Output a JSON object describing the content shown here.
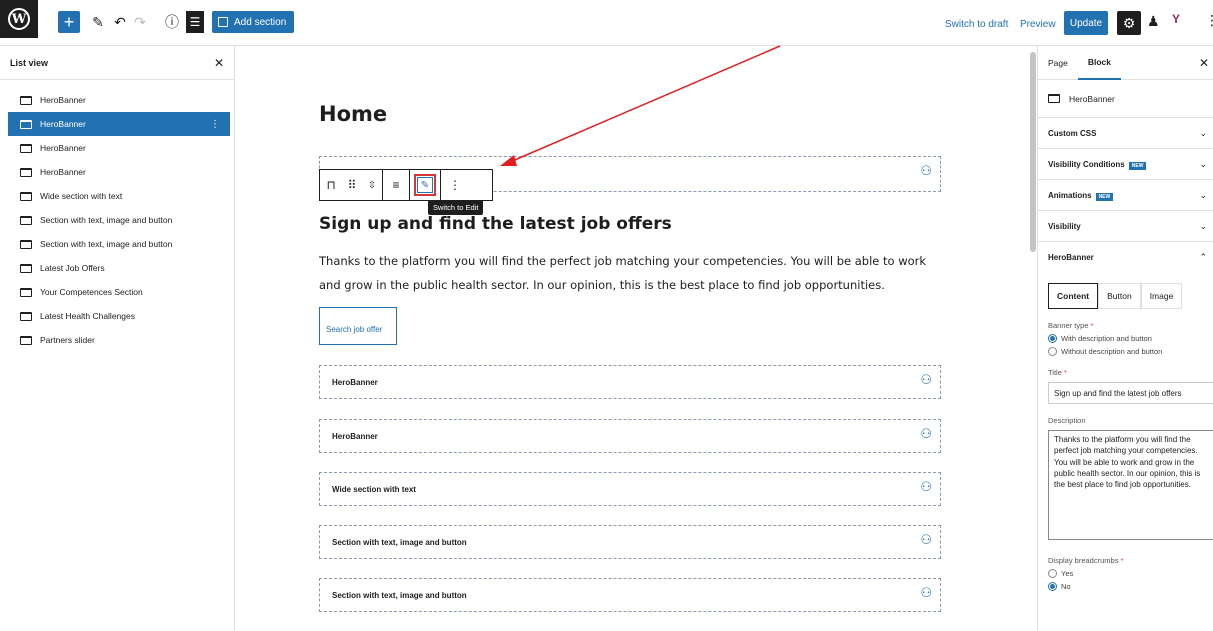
{
  "toolbar": {
    "add_section_label": "Add section",
    "switch_to_draft": "Switch to draft",
    "preview": "Preview",
    "update": "Update"
  },
  "list_view": {
    "title": "List view",
    "items": [
      "HeroBanner",
      "HeroBanner",
      "HeroBanner",
      "HeroBanner",
      "Wide section with text",
      "Section with text, image and button",
      "Section with text, image and button",
      "Latest Job Offers",
      "Your Competences Section",
      "Latest Health Challenges",
      "Partners slider"
    ],
    "selected_index": 1
  },
  "canvas": {
    "page_title": "Home",
    "tooltip": "Switch to Edit",
    "heading": "Sign up and find the latest job offers",
    "paragraph": "Thanks to the platform you will find the perfect job matching your competencies. You will be able to work and grow in the public health sector. In our opinion, this is the best place to find job opportunities.",
    "search_button": "Search job offer",
    "blocks": [
      "HeroBanner",
      "HeroBanner",
      "Wide section with text",
      "Section with text, image and button",
      "Section with text, image and button"
    ]
  },
  "inspector": {
    "tab_page": "Page",
    "tab_block": "Block",
    "block_name": "HeroBanner",
    "panels": {
      "custom_css": "Custom CSS",
      "visibility_conditions": "Visibility Conditions",
      "animations": "Animations",
      "visibility": "Visibility",
      "herobanner": "HeroBanner"
    },
    "new_badge": "NEW",
    "subtabs": [
      "Content",
      "Button",
      "Image"
    ],
    "banner_type_label": "Banner type",
    "banner_type_options": [
      "With description and button",
      "Without description and button"
    ],
    "title_label": "Title",
    "title_value": "Sign up and find the latest job offers",
    "description_label": "Description",
    "description_value": "Thanks to the platform you will find the perfect job matching your competencies. You will be able to work and grow in the public health sector. In our opinion, this is the best place to find job opportunities.",
    "breadcrumbs_label": "Display breadcrumbs",
    "breadcrumbs_options": [
      "Yes",
      "No"
    ]
  }
}
